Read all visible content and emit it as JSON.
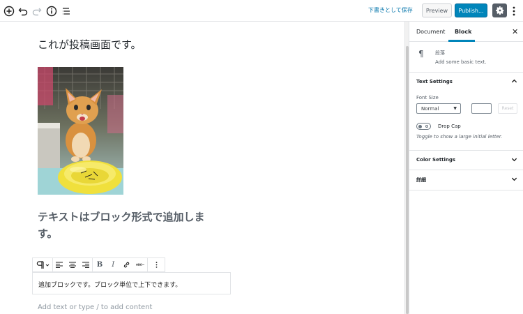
{
  "toolbar": {
    "save_draft": "下書きとして保存",
    "preview": "Preview",
    "publish": "Publish...",
    "accent": "#0085ba"
  },
  "editor": {
    "title": "これが投稿画面です。",
    "image": {
      "alt": "kitten-photo"
    },
    "heading": "テキストはブロック形式で追加します。",
    "paragraph": "追加ブロックです。ブロック単位で上下できます。",
    "placeholder": "Add text or type / to add content",
    "block_toolbar": [
      "paragraph-icon",
      "align-left-icon",
      "align-center-icon",
      "align-right-icon",
      "bold-icon",
      "italic-icon",
      "link-icon",
      "strikethrough-icon",
      "more-options-icon"
    ]
  },
  "sidebar": {
    "tabs": [
      {
        "label": "Document"
      },
      {
        "label": "Block"
      }
    ],
    "block_card": {
      "name": "段落",
      "description": "Add some basic text."
    },
    "text_settings": {
      "title": "Text Settings",
      "font_size_label": "Font Size",
      "font_size_value": "Normal",
      "reset_label": "Reset",
      "drop_cap_label": "Drop Cap",
      "drop_cap_help": "Toggle to show a large initial letter."
    },
    "color_settings": {
      "title": "Color Settings"
    },
    "advanced": {
      "title": "詳細"
    }
  }
}
